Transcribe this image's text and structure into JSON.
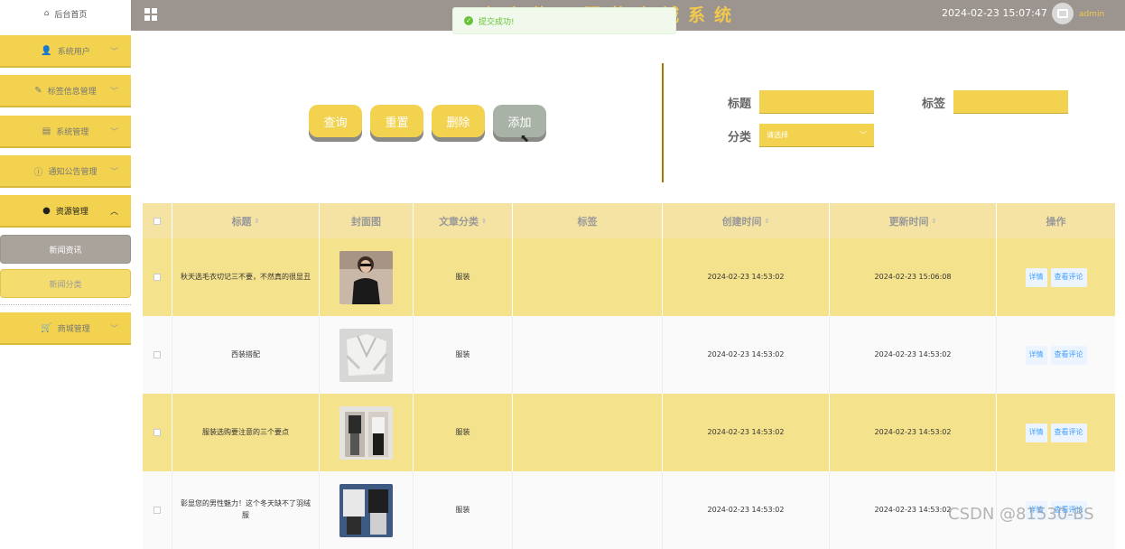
{
  "sidebar": {
    "home": "后台首页",
    "items": [
      {
        "label": "系统用户",
        "icon": "user-icon"
      },
      {
        "label": "标签信息管理",
        "icon": "edit-icon"
      },
      {
        "label": "系统管理",
        "icon": "chart-icon"
      },
      {
        "label": "通知公告管理",
        "icon": "info-icon"
      },
      {
        "label": "资源管理",
        "icon": "location-icon"
      },
      {
        "label": "商城管理",
        "icon": "cart-icon"
      }
    ],
    "sub_items": [
      {
        "label": "新闻资讯"
      },
      {
        "label": "新闻分类"
      }
    ]
  },
  "header": {
    "title": "欢迎使用服装商城系统",
    "datetime": "2024-02-23 15:07:47",
    "username": "admin"
  },
  "toast": {
    "message": "提交成功!"
  },
  "actions": {
    "query": "查询",
    "reset": "重置",
    "delete": "删除",
    "add": "添加"
  },
  "filters": {
    "title_label": "标题",
    "tag_label": "标签",
    "category_label": "分类",
    "category_placeholder": "请选择"
  },
  "table": {
    "columns": [
      "标题",
      "封面图",
      "文章分类",
      "标签",
      "创建时间",
      "更新时间",
      "操作"
    ],
    "rows": [
      {
        "title": "秋天选毛衣切记三不要，不然真的很显丑",
        "category": "服装",
        "tag": "",
        "created": "2024-02-23 14:53:02",
        "updated": "2024-02-23 15:06:08"
      },
      {
        "title": "西装搭配",
        "category": "服装",
        "tag": "",
        "created": "2024-02-23 14:53:02",
        "updated": "2024-02-23 14:53:02"
      },
      {
        "title": "服装选购要注意的三个要点",
        "category": "服装",
        "tag": "",
        "created": "2024-02-23 14:53:02",
        "updated": "2024-02-23 14:53:02"
      },
      {
        "title": "彰显您的男性魅力！这个冬天缺不了羽绒服",
        "category": "服装",
        "tag": "",
        "created": "2024-02-23 14:53:02",
        "updated": "2024-02-23 14:53:02"
      }
    ],
    "detail_label": "详情",
    "comments_label": "查看评论"
  },
  "watermark": "CSDN @81530-BS",
  "colors": {
    "accent": "#f2d24e",
    "topbar": "#9b948f",
    "title": "#f2c94c"
  }
}
